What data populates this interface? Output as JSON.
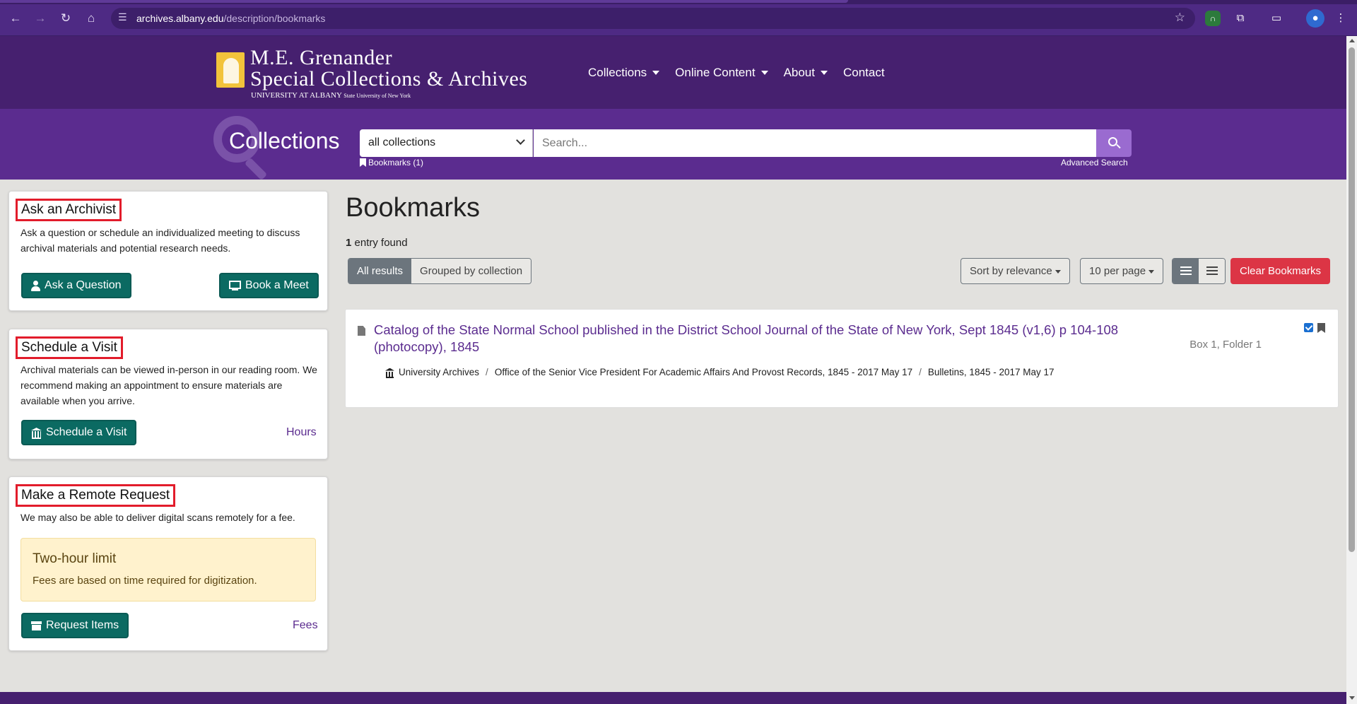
{
  "browser": {
    "url_domain": "archives.albany.edu",
    "url_path": "/description/bookmarks"
  },
  "header": {
    "logo_line1": "M.E. Grenander",
    "logo_line2": "Special Collections & Archives",
    "logo_line3_main": "UNIVERSITY AT ALBANY",
    "logo_line3_small": "State University of New York",
    "nav": [
      {
        "label": "Collections"
      },
      {
        "label": "Online Content"
      },
      {
        "label": "About"
      },
      {
        "label": "Contact"
      }
    ]
  },
  "search": {
    "section_title": "Collections",
    "scope_value": "all collections",
    "placeholder": "Search...",
    "bookmarks_link": "Bookmarks (1)",
    "advanced_link": "Advanced Search"
  },
  "sidebar": {
    "ask": {
      "heading": "Ask an Archivist",
      "description": "Ask a question or schedule an individualized meeting to discuss archival materials and potential research needs.",
      "button1": "Ask a Question",
      "button2": "Book a Meet"
    },
    "visit": {
      "heading": "Schedule a Visit",
      "description": "Archival materials can be viewed in-person in our reading room. We recommend making an appointment to ensure materials are available when you arrive.",
      "button": "Schedule a Visit",
      "link": "Hours"
    },
    "remote": {
      "heading": "Make a Remote Request",
      "description": "We may also be able to deliver digital scans remotely for a fee.",
      "notice_title": "Two-hour limit",
      "notice_text": "Fees are based on time required for digitization.",
      "button": "Request Items",
      "link": "Fees"
    }
  },
  "main": {
    "title": "Bookmarks",
    "entry_count": "1",
    "entry_suffix": " entry found",
    "tabs": [
      {
        "label": "All results",
        "active": true
      },
      {
        "label": "Grouped by collection",
        "active": false
      }
    ],
    "sort_label": "Sort by relevance",
    "per_page_label": "10 per page",
    "clear_label": "Clear Bookmarks",
    "results": [
      {
        "title": "Catalog of the State Normal School published in the District School Journal of the State of New York, Sept 1845 (v1,6) p 104-108 (photocopy), 1845",
        "location": "Box 1, Folder 1",
        "breadcrumb": [
          "University Archives",
          "Office of the Senior Vice President For Academic Affairs And Provost Records, 1845 - 2017 May 17",
          "Bulletins, 1845 - 2017 May 17"
        ]
      }
    ]
  },
  "colors": {
    "brand_purple": "#46206f",
    "band_purple": "#5b2c8f",
    "teal_button": "#0b6a62",
    "clear_red": "#dc3545",
    "highlight_border": "#e21c2b"
  }
}
